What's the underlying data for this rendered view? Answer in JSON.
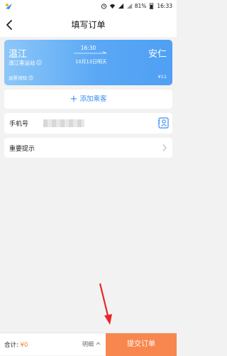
{
  "status_bar": {
    "battery": "81%",
    "time": "16:33"
  },
  "header": {
    "title": "填写订单"
  },
  "trip": {
    "from_city": "温江",
    "to_city": "安仁",
    "from_station": "温江客运站",
    "departure_time": "16:30",
    "departure_date": "10月13日",
    "departure_day": "明天",
    "refund_notice": "退票须知",
    "price": "¥11",
    "card_gradient": [
      "#8cc7f8",
      "#4f9ff4"
    ]
  },
  "passenger": {
    "add_label": "添加乘客",
    "accent": "#3a8ef0"
  },
  "contact": {
    "phone_label": "手机号"
  },
  "notice": {
    "label": "重要提示"
  },
  "footer": {
    "total_label": "合计:",
    "total_amount": "¥0",
    "detail_label": "明细",
    "submit_label": "提交订单",
    "submit_color": "#f7874e"
  },
  "icons": {
    "back": "back-arrow-icon",
    "contacts": "contact-book-icon",
    "chevron": "chevron-right-icon",
    "station_info": "info-icon",
    "refund_help": "help-icon"
  }
}
